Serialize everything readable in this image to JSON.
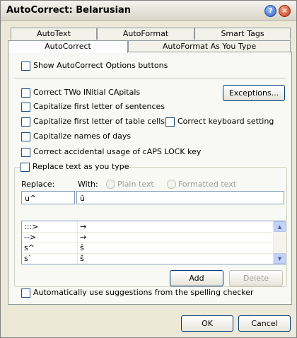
{
  "window": {
    "title": "AutoCorrect: Belarusian",
    "help_glyph": "?",
    "close_glyph": "×"
  },
  "tabs": {
    "top_row": [
      "AutoText",
      "AutoFormat",
      "Smart Tags"
    ],
    "bottom_row": [
      "AutoCorrect",
      "AutoFormat As You Type"
    ],
    "active": "AutoCorrect"
  },
  "options": {
    "show_buttons": "Show AutoCorrect Options buttons",
    "correct_two_initial": "Correct TWo INitial CApitals",
    "exceptions_button": "Exceptions...",
    "capitalize_sentences": "Capitalize first letter of sentences",
    "capitalize_table_cells": "Capitalize first letter of table cells",
    "correct_keyboard": "Correct keyboard setting",
    "capitalize_days": "Capitalize names of days",
    "caps_lock": "Correct accidental usage of cAPS LOCK key"
  },
  "replace_section": {
    "title": "Replace text as you type",
    "replace_label": "Replace:",
    "with_label": "With:",
    "plain_text": "Plain text",
    "formatted_text": "Formatted text",
    "replace_value": "u^",
    "with_value": "ŭ",
    "rows": [
      {
        "replace": ":::>",
        "with": "→"
      },
      {
        "replace": "-->",
        "with": "→"
      },
      {
        "replace": "s^",
        "with": "ŝ"
      },
      {
        "replace": "s`",
        "with": "š"
      }
    ],
    "add_button": "Add",
    "delete_button": "Delete",
    "auto_suggest": "Automatically use suggestions from the spelling checker"
  },
  "footer": {
    "ok": "OK",
    "cancel": "Cancel"
  }
}
